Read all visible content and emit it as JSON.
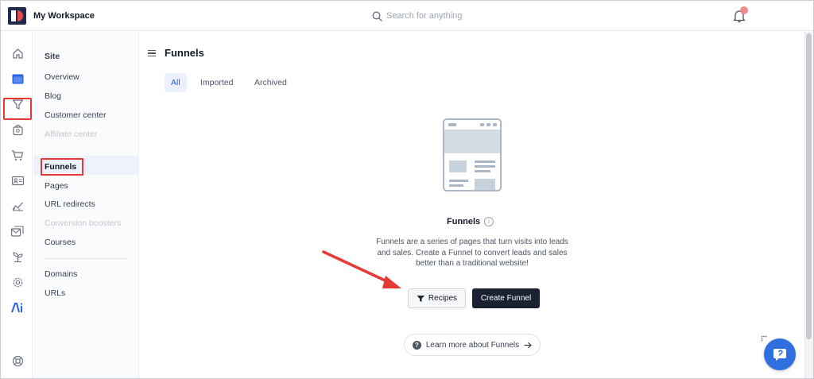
{
  "app": {
    "workspace_name": "My Workspace",
    "logo_icon": "clickfunnels-logo-icon"
  },
  "search": {
    "placeholder": "Search for anything",
    "icon": "search-icon"
  },
  "header": {
    "notifications_icon": "bell-icon",
    "notification_dot_color": "#f28b8b"
  },
  "rail": {
    "items": [
      {
        "icon": "home-icon"
      },
      {
        "icon": "browser-window-icon",
        "active": true
      },
      {
        "icon": "funnel-filter-icon"
      },
      {
        "icon": "store-bag-icon"
      },
      {
        "icon": "shopping-cart-icon"
      },
      {
        "icon": "contact-card-icon"
      },
      {
        "icon": "analytics-chart-icon"
      },
      {
        "icon": "email-stack-icon"
      },
      {
        "icon": "sprout-icon"
      },
      {
        "icon": "gear-icon"
      },
      {
        "icon": "ai-icon"
      },
      {
        "icon": "lifebuoy-icon"
      }
    ]
  },
  "sidebar": {
    "heading": "Site",
    "site_items": [
      {
        "label": "Overview"
      },
      {
        "label": "Blog"
      },
      {
        "label": "Customer center"
      },
      {
        "label": "Affiliate center",
        "disabled": true
      }
    ],
    "funnel_items": [
      {
        "label": "Funnels",
        "active": true
      },
      {
        "label": "Pages"
      },
      {
        "label": "URL redirects"
      },
      {
        "label": "Conversion boosters",
        "disabled": true
      },
      {
        "label": "Courses"
      }
    ],
    "domain_items": [
      {
        "label": "Domains"
      },
      {
        "label": "URLs"
      }
    ]
  },
  "main": {
    "title": "Funnels",
    "tabs": [
      {
        "label": "All",
        "active": true
      },
      {
        "label": "Imported"
      },
      {
        "label": "Archived"
      }
    ],
    "empty_state": {
      "title": "Funnels",
      "description": "Funnels are a series of pages that turn visits into leads and sales. Create a Funnel to convert leads and sales better than a traditional website!",
      "recipes_label": "Recipes",
      "create_label": "Create Funnel",
      "learn_more_label": "Learn more about Funnels"
    }
  },
  "colors": {
    "accent_blue": "#2563eb",
    "primary_dark": "#1a2130",
    "annotation_red": "#e53935",
    "help_button": "#2f6fe0"
  }
}
